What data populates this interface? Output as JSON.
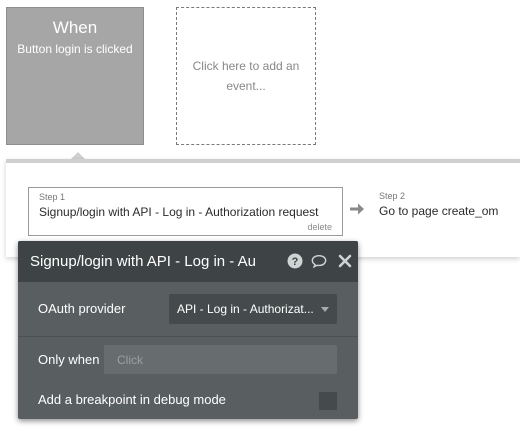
{
  "event": {
    "when_label": "When",
    "trigger_text": "Button login is clicked",
    "add_event_text": "Click here to add an event..."
  },
  "steps": [
    {
      "number_label": "Step 1",
      "title": "Signup/login with API - Log in - Authorization request",
      "delete_label": "delete"
    },
    {
      "number_label": "Step 2",
      "title": "Go to page create_om"
    }
  ],
  "panel": {
    "title": "Signup/login with API - Log in - Au",
    "icons": [
      "help-icon",
      "comment-icon",
      "close-icon"
    ],
    "oauth_provider": {
      "label": "OAuth provider",
      "selected": "API - Log in - Authorizat..."
    },
    "only_when": {
      "label": "Only when",
      "placeholder": "Click"
    },
    "breakpoint": {
      "label": "Add a breakpoint in debug mode",
      "checked": false
    }
  },
  "colors": {
    "event_card": "#a6a6a6",
    "panel_bg": "#595f60",
    "panel_header": "#3e4445"
  }
}
